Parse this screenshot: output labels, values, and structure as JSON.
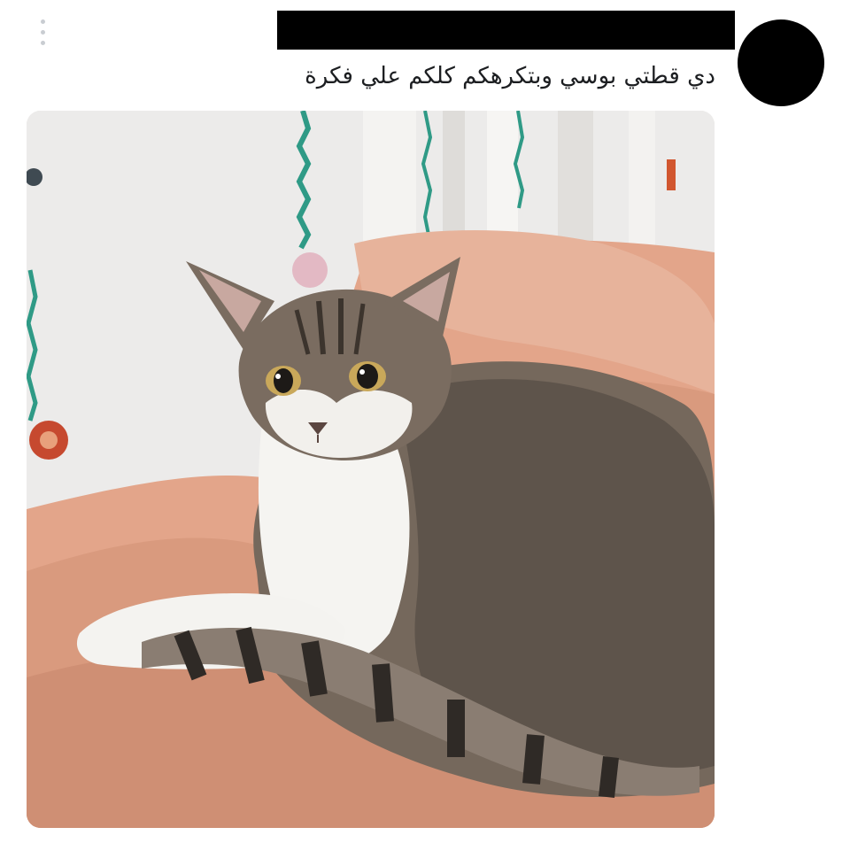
{
  "post": {
    "author_name_redacted": true,
    "text": "دي قطتي بوسي وبتكرهكم كلكم علي فكرة"
  },
  "icons": {
    "more": "more-vertical-icon",
    "avatar": "avatar"
  },
  "colors": {
    "background": "#ffffff",
    "text": "#1c1e21",
    "redaction": "#000000",
    "more_dots": "#c9cdd2"
  }
}
